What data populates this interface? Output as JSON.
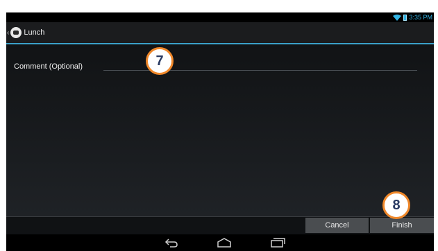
{
  "status_bar": {
    "time": "3:35 PM"
  },
  "action_bar": {
    "title": "Lunch"
  },
  "form": {
    "comment_label": "Comment (Optional)",
    "comment_value": ""
  },
  "buttons": {
    "cancel_label": "Cancel",
    "finish_label": "Finish"
  },
  "callouts": {
    "badge_a": "7",
    "badge_b": "8"
  },
  "colors": {
    "accent": "#33b5e5",
    "callout_border": "#f0882a",
    "callout_text": "#2a3b63"
  }
}
